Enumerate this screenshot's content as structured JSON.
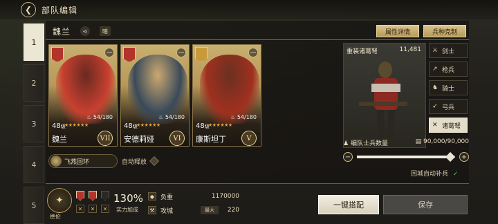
{
  "header": {
    "title": "部队编辑"
  },
  "tabs": [
    "1",
    "2",
    "3",
    "4",
    "5"
  ],
  "commander": {
    "name": "魏兰",
    "hidden_label": "暗"
  },
  "top_buttons": {
    "attr_detail": "属性详情",
    "counter": "兵种克制"
  },
  "cards": [
    {
      "level": "48",
      "level_suffix": "级",
      "stars": "★★★★★★",
      "troops": "54/180",
      "name": "魏兰",
      "rank": "VII",
      "badge_color": "#b3342a",
      "portrait_colors": [
        "#6a2a20",
        "#c84030"
      ]
    },
    {
      "level": "48",
      "level_suffix": "级",
      "stars": "★★★★★★",
      "troops": "54/180",
      "name": "安德莉娅",
      "rank": "VI",
      "badge_color": "#b3342a",
      "portrait_colors": [
        "#caa870",
        "#3a4a5a"
      ]
    },
    {
      "level": "48",
      "level_suffix": "级",
      "stars": "★★★★★★",
      "troops": "54/180",
      "name": "康斯坦丁",
      "rank": "V",
      "badge_color": "#c89a3a",
      "portrait_colors": [
        "#6a3020",
        "#a03020"
      ]
    }
  ],
  "skill": {
    "name": "飞燕回环",
    "auto_label": "自动释放"
  },
  "troop": {
    "name": "重装诸葛弩",
    "count": "11,481",
    "list": [
      {
        "label": "剑士",
        "icon": "sword-icon",
        "glyph": "⚔"
      },
      {
        "label": "枪兵",
        "icon": "spear-icon",
        "glyph": "↗"
      },
      {
        "label": "骑士",
        "icon": "horse-icon",
        "glyph": "♞"
      },
      {
        "label": "弓兵",
        "icon": "bow-icon",
        "glyph": "➶"
      },
      {
        "label": "诸葛弩",
        "icon": "crossbow-icon",
        "glyph": "✕",
        "selected": true
      }
    ],
    "soldier_label": "编队士兵数量",
    "soldier_value": "90,000/90,000",
    "fill_fraction": 0.95,
    "refill_label": "回城自动补兵"
  },
  "bottom": {
    "formation_label": "绝伦",
    "percent": "130%",
    "percent_label": "实力加成",
    "load_label": "负重",
    "load_value": "1170000",
    "siege_label": "攻城",
    "siege_tag": "最大",
    "siege_value": "220",
    "one_key": "一键搭配",
    "save": "保存"
  }
}
